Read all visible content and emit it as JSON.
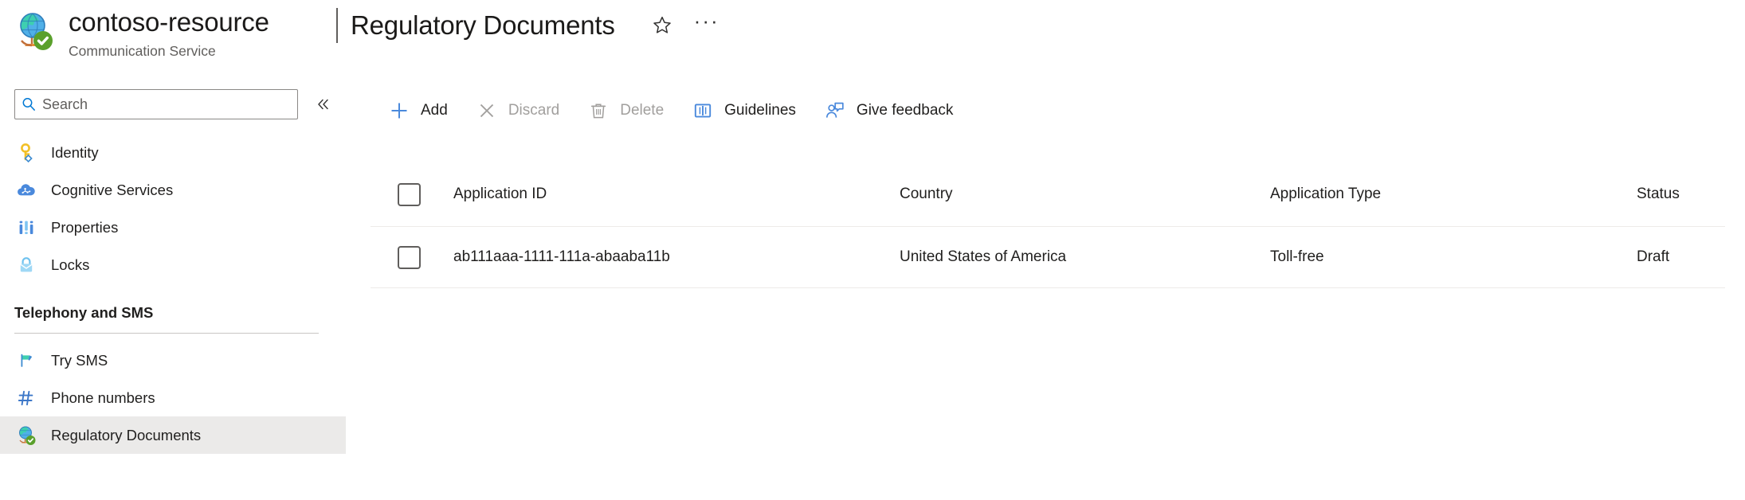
{
  "header": {
    "resource_icon": "globe-check-icon",
    "resource_name": "contoso-resource",
    "resource_subtitle": "Communication Service",
    "title_separator": "|",
    "page_title": "Regulatory Documents",
    "favorite_icon": "star-outline-icon",
    "more_actions_label": "···"
  },
  "sidebar": {
    "search": {
      "icon": "search-icon",
      "placeholder": "Search",
      "value": ""
    },
    "collapse_icon": "chevron-double-left-icon",
    "items": [
      {
        "label": "Identity",
        "icon": "key-icon",
        "selected": false
      },
      {
        "label": "Cognitive Services",
        "icon": "cloud-brain-icon",
        "selected": false
      },
      {
        "label": "Properties",
        "icon": "properties-bars-icon",
        "selected": false
      },
      {
        "label": "Locks",
        "icon": "lock-icon",
        "selected": false
      }
    ],
    "section": {
      "title": "Telephony and SMS",
      "items": [
        {
          "label": "Try SMS",
          "icon": "flag-icon",
          "selected": false
        },
        {
          "label": "Phone numbers",
          "icon": "hash-icon",
          "selected": false
        },
        {
          "label": "Regulatory Documents",
          "icon": "globe-check-icon",
          "selected": true
        }
      ]
    }
  },
  "toolbar": {
    "buttons": [
      {
        "label": "Add",
        "icon": "plus-icon",
        "disabled": false
      },
      {
        "label": "Discard",
        "icon": "close-x-icon",
        "disabled": true
      },
      {
        "label": "Delete",
        "icon": "trash-icon",
        "disabled": true
      },
      {
        "label": "Guidelines",
        "icon": "book-icon",
        "disabled": false
      },
      {
        "label": "Give feedback",
        "icon": "feedback-person-icon",
        "disabled": false
      }
    ]
  },
  "table": {
    "select_all_checkbox": "unchecked",
    "columns": [
      "Application ID",
      "Country",
      "Application Type",
      "Status"
    ],
    "rows": [
      {
        "checked": false,
        "application_id": "ab111aaa-1111-111a-abaaba11b",
        "country": "United States of America",
        "application_type": "Toll-free",
        "status": "Draft"
      }
    ]
  },
  "colors": {
    "accent_blue": "#0078d4",
    "icon_blue": "#4a89dc",
    "selected_row_bg": "#ebeae9",
    "divider": "#edebe9",
    "text_primary": "#201f1e",
    "text_secondary": "#605e5c",
    "text_disabled": "#a19f9d",
    "green_check": "#5aa02c"
  }
}
